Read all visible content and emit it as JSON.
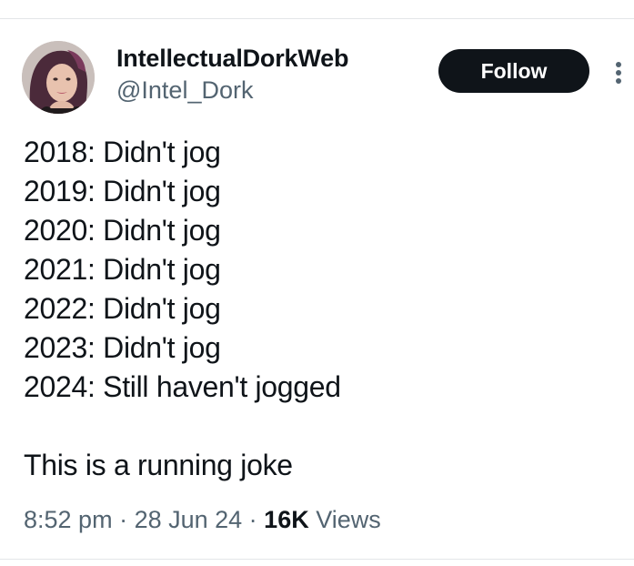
{
  "author": {
    "display_name": "IntellectualDorkWeb",
    "handle": "@Intel_Dork",
    "avatar_icon": "profile-photo"
  },
  "actions": {
    "follow_label": "Follow",
    "more_icon": "vertical-ellipsis-icon"
  },
  "tweet": {
    "lines": [
      "2018:  Didn't jog",
      "2019:  Didn't jog",
      "2020: Didn't jog",
      "2021:  Didn't jog",
      "2022: Didn't jog",
      "2023: Didn't jog",
      "2024: Still haven't jogged"
    ],
    "punchline": "This is a running joke"
  },
  "meta": {
    "time": "8:52 pm",
    "separator": " · ",
    "date": "28 Jun 24",
    "views_count": "16K",
    "views_label": " Views"
  },
  "colors": {
    "text": "#0f1419",
    "secondary": "#536471",
    "button_bg": "#0f1419",
    "divider": "#e3e6e8"
  }
}
